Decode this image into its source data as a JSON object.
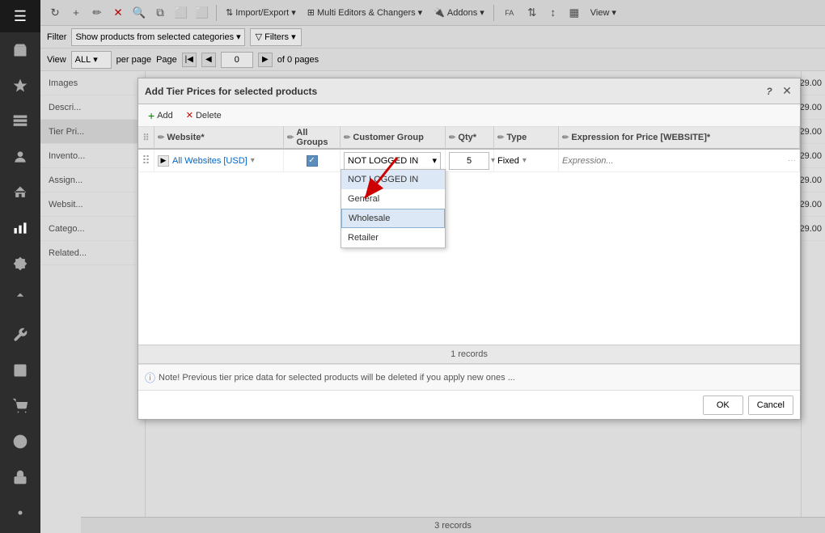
{
  "sidebar": {
    "items": [
      {
        "id": "menu",
        "icon": "☰"
      },
      {
        "id": "store",
        "icon": "🏪"
      },
      {
        "id": "star",
        "icon": "★"
      },
      {
        "id": "catalog",
        "icon": "📋"
      },
      {
        "id": "user",
        "icon": "👤"
      },
      {
        "id": "house",
        "icon": "🏠"
      },
      {
        "id": "chart",
        "icon": "📊"
      },
      {
        "id": "puzzle",
        "icon": "🧩"
      },
      {
        "id": "upload",
        "icon": "⬆"
      },
      {
        "id": "wrench",
        "icon": "🔧"
      },
      {
        "id": "book",
        "icon": "📚"
      },
      {
        "id": "disk",
        "icon": "💾"
      },
      {
        "id": "question",
        "icon": "?"
      },
      {
        "id": "lock",
        "icon": "🔒"
      },
      {
        "id": "gear",
        "icon": "⚙"
      }
    ]
  },
  "toolbar": {
    "buttons": [
      "↻",
      "+",
      "✏",
      "✕",
      "🔍",
      "⧉",
      "⬜",
      "⬜"
    ],
    "import_export": "Import/Export",
    "multi_editors": "Multi Editors & Changers",
    "addons": "Addons",
    "fa_icon": "FA",
    "view": "View"
  },
  "filter_bar": {
    "filter_label": "Filter",
    "show_products": "Show products from selected categories",
    "filters_btn": "Filters"
  },
  "view_bar": {
    "view_label": "View",
    "all_option": "ALL",
    "per_page_label": "per page",
    "page_label": "Page",
    "page_number": "0",
    "of_pages": "of 0 pages"
  },
  "modal": {
    "title": "Add Tier Prices for selected products",
    "help": "?",
    "add_btn": "Add",
    "delete_btn": "Delete",
    "columns": {
      "drag": "",
      "website": "Website*",
      "all_groups": "All Groups",
      "customer_group": "Customer Group",
      "qty": "Qty*",
      "type": "Type",
      "expression": "Expression for Price [WEBSITE]*"
    },
    "row": {
      "website": "All Websites [USD]",
      "all_groups_checked": true,
      "customer_group": "NOT LOGGED IN",
      "qty": "5",
      "type": "Fixed",
      "expression_placeholder": "Expression..."
    },
    "dropdown_options": [
      {
        "value": "NOT LOGGED IN",
        "label": "NOT LOGGED IN",
        "selected": true
      },
      {
        "value": "General",
        "label": "General",
        "selected": false
      },
      {
        "value": "Wholesale",
        "label": "Wholesale",
        "selected": false,
        "highlighted": true
      },
      {
        "value": "Retailer",
        "label": "Retailer",
        "selected": false
      }
    ],
    "records_count": "1 records",
    "note": "Note! Previous tier price data for selected products will be deleted if you apply new ones ...",
    "ok_btn": "OK",
    "cancel_btn": "Cancel"
  },
  "left_panel": {
    "items": [
      "Images",
      "Descri...",
      "Tier Pri...",
      "Invento...",
      "Assign...",
      "Websit...",
      "Catego...",
      "Related..."
    ]
  },
  "right_prices": {
    "values": [
      "29.00",
      "29.00",
      "29.00",
      "29.00",
      "29.00",
      "29.00",
      "29.00"
    ]
  },
  "bottom": {
    "records": "3 records"
  }
}
